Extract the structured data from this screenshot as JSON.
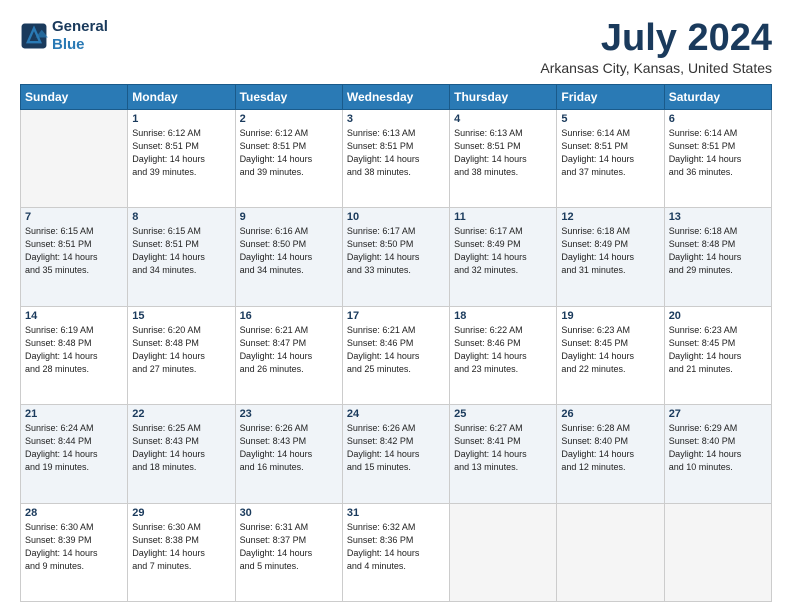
{
  "header": {
    "logo_line1": "General",
    "logo_line2": "Blue",
    "title": "July 2024",
    "subtitle": "Arkansas City, Kansas, United States"
  },
  "weekdays": [
    "Sunday",
    "Monday",
    "Tuesday",
    "Wednesday",
    "Thursday",
    "Friday",
    "Saturday"
  ],
  "weeks": [
    [
      {
        "num": "",
        "info": ""
      },
      {
        "num": "1",
        "info": "Sunrise: 6:12 AM\nSunset: 8:51 PM\nDaylight: 14 hours\nand 39 minutes."
      },
      {
        "num": "2",
        "info": "Sunrise: 6:12 AM\nSunset: 8:51 PM\nDaylight: 14 hours\nand 39 minutes."
      },
      {
        "num": "3",
        "info": "Sunrise: 6:13 AM\nSunset: 8:51 PM\nDaylight: 14 hours\nand 38 minutes."
      },
      {
        "num": "4",
        "info": "Sunrise: 6:13 AM\nSunset: 8:51 PM\nDaylight: 14 hours\nand 38 minutes."
      },
      {
        "num": "5",
        "info": "Sunrise: 6:14 AM\nSunset: 8:51 PM\nDaylight: 14 hours\nand 37 minutes."
      },
      {
        "num": "6",
        "info": "Sunrise: 6:14 AM\nSunset: 8:51 PM\nDaylight: 14 hours\nand 36 minutes."
      }
    ],
    [
      {
        "num": "7",
        "info": "Sunrise: 6:15 AM\nSunset: 8:51 PM\nDaylight: 14 hours\nand 35 minutes."
      },
      {
        "num": "8",
        "info": "Sunrise: 6:15 AM\nSunset: 8:51 PM\nDaylight: 14 hours\nand 34 minutes."
      },
      {
        "num": "9",
        "info": "Sunrise: 6:16 AM\nSunset: 8:50 PM\nDaylight: 14 hours\nand 34 minutes."
      },
      {
        "num": "10",
        "info": "Sunrise: 6:17 AM\nSunset: 8:50 PM\nDaylight: 14 hours\nand 33 minutes."
      },
      {
        "num": "11",
        "info": "Sunrise: 6:17 AM\nSunset: 8:49 PM\nDaylight: 14 hours\nand 32 minutes."
      },
      {
        "num": "12",
        "info": "Sunrise: 6:18 AM\nSunset: 8:49 PM\nDaylight: 14 hours\nand 31 minutes."
      },
      {
        "num": "13",
        "info": "Sunrise: 6:18 AM\nSunset: 8:48 PM\nDaylight: 14 hours\nand 29 minutes."
      }
    ],
    [
      {
        "num": "14",
        "info": "Sunrise: 6:19 AM\nSunset: 8:48 PM\nDaylight: 14 hours\nand 28 minutes."
      },
      {
        "num": "15",
        "info": "Sunrise: 6:20 AM\nSunset: 8:48 PM\nDaylight: 14 hours\nand 27 minutes."
      },
      {
        "num": "16",
        "info": "Sunrise: 6:21 AM\nSunset: 8:47 PM\nDaylight: 14 hours\nand 26 minutes."
      },
      {
        "num": "17",
        "info": "Sunrise: 6:21 AM\nSunset: 8:46 PM\nDaylight: 14 hours\nand 25 minutes."
      },
      {
        "num": "18",
        "info": "Sunrise: 6:22 AM\nSunset: 8:46 PM\nDaylight: 14 hours\nand 23 minutes."
      },
      {
        "num": "19",
        "info": "Sunrise: 6:23 AM\nSunset: 8:45 PM\nDaylight: 14 hours\nand 22 minutes."
      },
      {
        "num": "20",
        "info": "Sunrise: 6:23 AM\nSunset: 8:45 PM\nDaylight: 14 hours\nand 21 minutes."
      }
    ],
    [
      {
        "num": "21",
        "info": "Sunrise: 6:24 AM\nSunset: 8:44 PM\nDaylight: 14 hours\nand 19 minutes."
      },
      {
        "num": "22",
        "info": "Sunrise: 6:25 AM\nSunset: 8:43 PM\nDaylight: 14 hours\nand 18 minutes."
      },
      {
        "num": "23",
        "info": "Sunrise: 6:26 AM\nSunset: 8:43 PM\nDaylight: 14 hours\nand 16 minutes."
      },
      {
        "num": "24",
        "info": "Sunrise: 6:26 AM\nSunset: 8:42 PM\nDaylight: 14 hours\nand 15 minutes."
      },
      {
        "num": "25",
        "info": "Sunrise: 6:27 AM\nSunset: 8:41 PM\nDaylight: 14 hours\nand 13 minutes."
      },
      {
        "num": "26",
        "info": "Sunrise: 6:28 AM\nSunset: 8:40 PM\nDaylight: 14 hours\nand 12 minutes."
      },
      {
        "num": "27",
        "info": "Sunrise: 6:29 AM\nSunset: 8:40 PM\nDaylight: 14 hours\nand 10 minutes."
      }
    ],
    [
      {
        "num": "28",
        "info": "Sunrise: 6:30 AM\nSunset: 8:39 PM\nDaylight: 14 hours\nand 9 minutes."
      },
      {
        "num": "29",
        "info": "Sunrise: 6:30 AM\nSunset: 8:38 PM\nDaylight: 14 hours\nand 7 minutes."
      },
      {
        "num": "30",
        "info": "Sunrise: 6:31 AM\nSunset: 8:37 PM\nDaylight: 14 hours\nand 5 minutes."
      },
      {
        "num": "31",
        "info": "Sunrise: 6:32 AM\nSunset: 8:36 PM\nDaylight: 14 hours\nand 4 minutes."
      },
      {
        "num": "",
        "info": ""
      },
      {
        "num": "",
        "info": ""
      },
      {
        "num": "",
        "info": ""
      }
    ]
  ]
}
